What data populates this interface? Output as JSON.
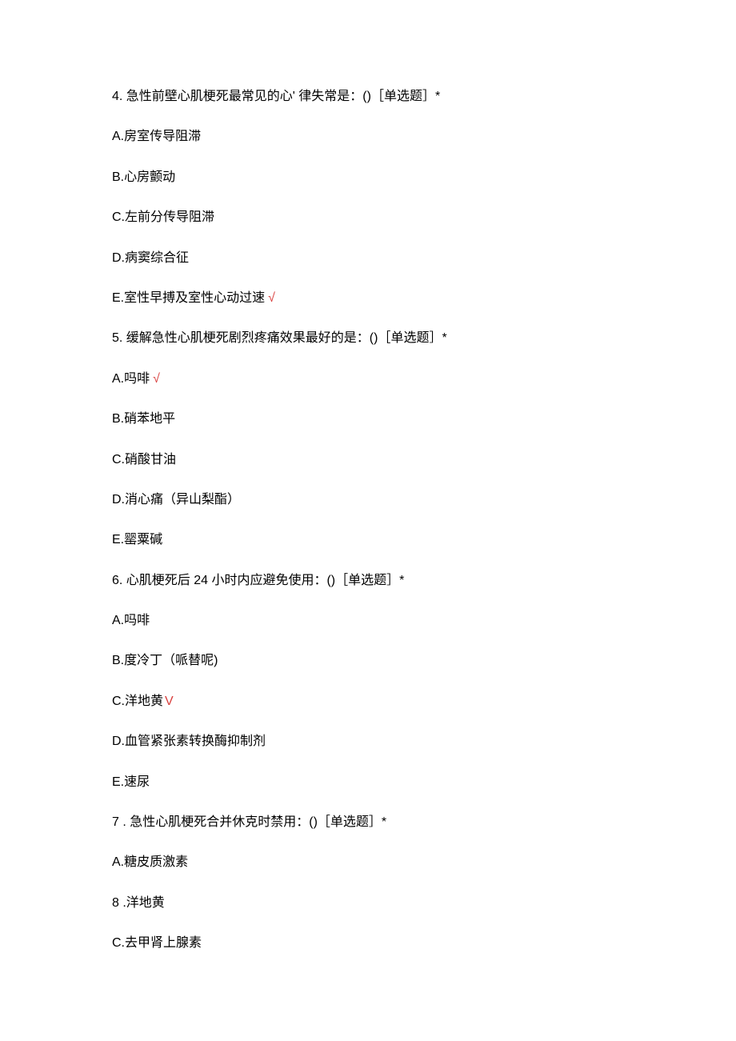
{
  "q4": {
    "stem": "4. 急性前壁心肌梗死最常见的心' 律失常是：()［单选题］*",
    "A": "A.房室传导阻滞",
    "B": "B.心房颤动",
    "C": "C.左前分传导阻滞",
    "D": "D.病窦综合征",
    "E": "E.室性早搏及室性心动过速",
    "E_mark": "√"
  },
  "q5": {
    "stem": "5. 缓解急性心肌梗死剧烈疼痛效果最好的是：()［单选题］*",
    "A": "A.吗啡",
    "A_mark": "√",
    "B": "B.硝苯地平",
    "C": "C.硝酸甘油",
    "D": "D.消心痛（异山梨酯）",
    "E": "E.罂粟碱"
  },
  "q6": {
    "stem": "6. 心肌梗死后 24 小时内应避免使用：()［单选题］*",
    "A": "A.吗啡",
    "B": "B.度冷丁（哌替呢)",
    "C": "C.洋地黄",
    "C_mark": "V",
    "D": "D.血管紧张素转换酶抑制剂",
    "E": "E.速尿"
  },
  "q7": {
    "stem": "7 . 急性心肌梗死合并休克时禁用：()［单选题］*",
    "A": "A.糖皮质激素",
    "B": "8 .洋地黄",
    "C": "C.去甲肾上腺素"
  }
}
